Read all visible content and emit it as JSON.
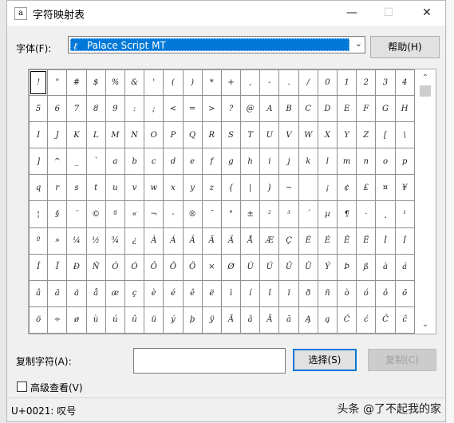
{
  "window": {
    "title": "字符映射表",
    "minimize_symbol": "—",
    "maximize_symbol": "☐",
    "close_symbol": "✕"
  },
  "font_row": {
    "label": "字体(F):",
    "selected_font": "Palace Script MT",
    "dropdown_arrow": "⌄",
    "help_button": "帮助(H)"
  },
  "grid": {
    "rows": [
      [
        "!",
        "\"",
        "#",
        "$",
        "%",
        "&",
        "'",
        "(",
        ")",
        "*",
        "+",
        ",",
        "-",
        ".",
        "/",
        "0",
        "1",
        "2",
        "3",
        "4"
      ],
      [
        "5",
        "6",
        "7",
        "8",
        "9",
        ":",
        ";",
        "<",
        "=",
        ">",
        "?",
        "@",
        "A",
        "B",
        "C",
        "D",
        "E",
        "F",
        "G",
        "H"
      ],
      [
        "I",
        "J",
        "K",
        "L",
        "M",
        "N",
        "O",
        "P",
        "Q",
        "R",
        "S",
        "T",
        "U",
        "V",
        "W",
        "X",
        "Y",
        "Z",
        "[",
        "\\"
      ],
      [
        "]",
        "^",
        "_",
        "`",
        "a",
        "b",
        "c",
        "d",
        "e",
        "f",
        "g",
        "h",
        "i",
        "j",
        "k",
        "l",
        "m",
        "n",
        "o",
        "p"
      ],
      [
        "q",
        "r",
        "s",
        "t",
        "u",
        "v",
        "w",
        "x",
        "y",
        "z",
        "{",
        "|",
        "}",
        "~",
        "",
        "¡",
        "¢",
        "£",
        "¤",
        "¥"
      ],
      [
        "¦",
        "§",
        "¨",
        "©",
        "ª",
        "«",
        "¬",
        "-",
        "®",
        "¯",
        "°",
        "±",
        "²",
        "³",
        "´",
        "µ",
        "¶",
        "·",
        "¸",
        "¹"
      ],
      [
        "º",
        "»",
        "¼",
        "½",
        "¾",
        "¿",
        "À",
        "Á",
        "Â",
        "Ã",
        "Ä",
        "Å",
        "Æ",
        "Ç",
        "È",
        "É",
        "Ê",
        "Ë",
        "Ì",
        "Í"
      ],
      [
        "Î",
        "Ï",
        "Ð",
        "Ñ",
        "Ò",
        "Ó",
        "Ô",
        "Õ",
        "Ö",
        "×",
        "Ø",
        "Ù",
        "Ú",
        "Û",
        "Ü",
        "Ý",
        "Þ",
        "ß",
        "à",
        "á"
      ],
      [
        "â",
        "ã",
        "ä",
        "å",
        "æ",
        "ç",
        "è",
        "é",
        "ê",
        "ë",
        "ì",
        "í",
        "î",
        "ï",
        "ð",
        "ñ",
        "ò",
        "ó",
        "ô",
        "õ"
      ],
      [
        "ö",
        "÷",
        "ø",
        "ù",
        "ú",
        "û",
        "ü",
        "ý",
        "þ",
        "ÿ",
        "Ā",
        "ā",
        "Ă",
        "ă",
        "Ą",
        "ą",
        "Ć",
        "ć",
        "Ĉ",
        "ĉ"
      ]
    ],
    "scroll_up": "⌃",
    "scroll_down": "⌄"
  },
  "copy_row": {
    "label": "复制字符(A):",
    "value": "",
    "select_button": "选择(S)",
    "copy_button": "复制(C)"
  },
  "advanced": {
    "label": "高级查看(V)",
    "checked": false
  },
  "status": {
    "text": "U+0021: 叹号",
    "watermark": "头条 @了不起我的家"
  }
}
